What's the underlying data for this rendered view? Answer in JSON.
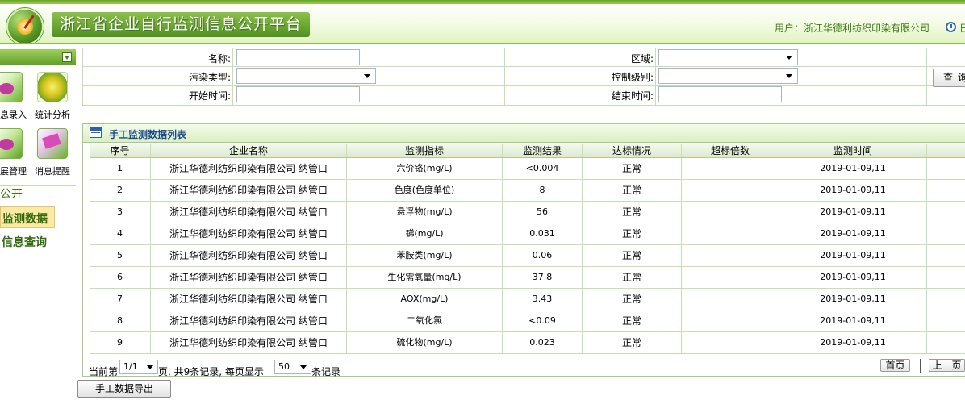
{
  "header": {
    "title": "浙江省企业自行监测信息公开平台",
    "user_label": "用户：",
    "user_name": "浙江华德利纺织印染有限公司",
    "clock_text": "日"
  },
  "sidebar": {
    "tools": [
      {
        "label": "息录入",
        "icon": "data-entry-icon"
      },
      {
        "label": "统计分析",
        "icon": "statistics-icon"
      },
      {
        "label": "展管理",
        "icon": "management-icon"
      },
      {
        "label": "消息提醒",
        "icon": "message-icon"
      }
    ],
    "section_title": "公开",
    "active_item": "监测数据",
    "query_item": "信息查询"
  },
  "form": {
    "name_label": "名称:",
    "region_label": "区域:",
    "pollution_label": "污染类型:",
    "control_label": "控制级别:",
    "start_label": "开始时间:",
    "end_label": "结束时间:",
    "name_value": "",
    "region_value": "",
    "pollution_value": "",
    "control_value": "",
    "start_value": "",
    "end_value": "",
    "search_button": "查询"
  },
  "panel": {
    "title": "手工监测数据列表",
    "columns": [
      "序号",
      "企业名称",
      "监测指标",
      "监测结果",
      "达标情况",
      "超标倍数",
      "监测时间",
      ""
    ],
    "rows": [
      {
        "no": "1",
        "company": "浙江华德利纺织印染有限公司 纳管口",
        "indicator": "六价铬(mg/L)",
        "result": "<0.004",
        "status": "正常",
        "exceed": "",
        "time": "2019-01-09,11"
      },
      {
        "no": "2",
        "company": "浙江华德利纺织印染有限公司 纳管口",
        "indicator": "色度(色度单位)",
        "result": "8",
        "status": "正常",
        "exceed": "",
        "time": "2019-01-09,11"
      },
      {
        "no": "3",
        "company": "浙江华德利纺织印染有限公司 纳管口",
        "indicator": "悬浮物(mg/L)",
        "result": "56",
        "status": "正常",
        "exceed": "",
        "time": "2019-01-09,11"
      },
      {
        "no": "4",
        "company": "浙江华德利纺织印染有限公司 纳管口",
        "indicator": "锑(mg/L)",
        "result": "0.031",
        "status": "正常",
        "exceed": "",
        "time": "2019-01-09,11"
      },
      {
        "no": "5",
        "company": "浙江华德利纺织印染有限公司 纳管口",
        "indicator": "苯胺类(mg/L)",
        "result": "0.06",
        "status": "正常",
        "exceed": "",
        "time": "2019-01-09,11"
      },
      {
        "no": "6",
        "company": "浙江华德利纺织印染有限公司 纳管口",
        "indicator": "生化需氧量(mg/L)",
        "result": "37.8",
        "status": "正常",
        "exceed": "",
        "time": "2019-01-09,11"
      },
      {
        "no": "7",
        "company": "浙江华德利纺织印染有限公司 纳管口",
        "indicator": "AOX(mg/L)",
        "result": "3.43",
        "status": "正常",
        "exceed": "",
        "time": "2019-01-09,11"
      },
      {
        "no": "8",
        "company": "浙江华德利纺织印染有限公司 纳管口",
        "indicator": "二氧化氯",
        "result": "<0.09",
        "status": "正常",
        "exceed": "",
        "time": "2019-01-09,11"
      },
      {
        "no": "9",
        "company": "浙江华德利纺织印染有限公司 纳管口",
        "indicator": "硫化物(mg/L)",
        "result": "0.023",
        "status": "正常",
        "exceed": "",
        "time": "2019-01-09,11"
      }
    ]
  },
  "pager": {
    "current_label": "当前第",
    "page_value": "1/1",
    "page_suffix": "页,  共9条记录, 每页显示",
    "page_size": "50",
    "size_suffix": "条记录",
    "first_button": "首页",
    "prev_button": "上一页"
  },
  "export_button": "手工数据导出",
  "colors": {
    "brand_green": "#5a9b28",
    "header_green": "#3d7a12",
    "panel_title_blue": "#1a4a8a",
    "active_highlight": "#fbe9a5"
  }
}
